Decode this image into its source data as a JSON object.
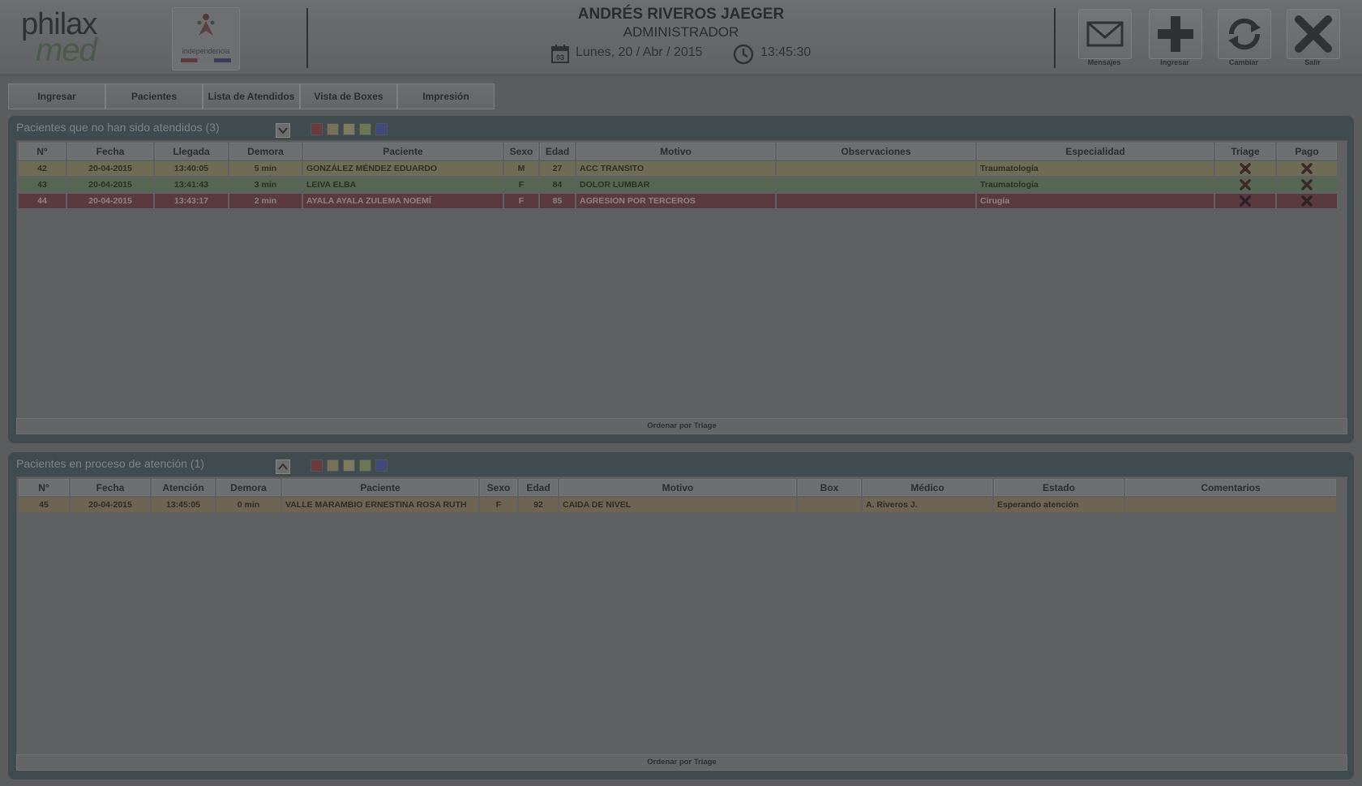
{
  "header": {
    "logo_top": "philax",
    "logo_bottom": "med",
    "municipality": "independencia",
    "user_name": "ANDRÉS RIVEROS JAEGER",
    "user_role": "ADMINISTRADOR",
    "date": "Lunes, 20 / Abr / 2015",
    "time": "13:45:30",
    "buttons": [
      {
        "label": "Mensajes",
        "icon": "envelope-icon"
      },
      {
        "label": "Ingresar",
        "icon": "plus-icon"
      },
      {
        "label": "Cambiar",
        "icon": "refresh-icon"
      },
      {
        "label": "Salir",
        "icon": "close-icon"
      }
    ]
  },
  "tabs": [
    "Ingresar",
    "Pacientes",
    "Lista de Atendidos",
    "Vista de Boxes",
    "Impresión"
  ],
  "triage_colors": [
    "#6a3a3d",
    "#76715a",
    "#7c7a5f",
    "#6a7858",
    "#3e4a78"
  ],
  "waiting": {
    "title": "Pacientes que no han sido atendidos (3)",
    "columns": [
      "N°",
      "Fecha",
      "Llegada",
      "Demora",
      "Paciente",
      "Sexo",
      "Edad",
      "Motivo",
      "Observaciones",
      "Especialidad",
      "Triage",
      "Pago"
    ],
    "rows": [
      {
        "n": "42",
        "fecha": "20-04-2015",
        "llegada": "13:40:05",
        "demora": "5 min",
        "paciente": "GONZÁLEZ MÉNDEZ EDUARDO",
        "sexo": "M",
        "edad": "27",
        "motivo": "ACC TRANSITO",
        "obs": "",
        "especialidad": "Traumatología",
        "color": "yellow"
      },
      {
        "n": "43",
        "fecha": "20-04-2015",
        "llegada": "13:41:43",
        "demora": "3 min",
        "paciente": "LEIVA ELBA",
        "sexo": "F",
        "edad": "84",
        "motivo": "DOLOR LUMBAR",
        "obs": "",
        "especialidad": "Traumatología",
        "color": "green"
      },
      {
        "n": "44",
        "fecha": "20-04-2015",
        "llegada": "13:43:17",
        "demora": "2 min",
        "paciente": "AYALA AYALA ZULEMA NOEMÍ",
        "sexo": "F",
        "edad": "85",
        "motivo": "AGRESION POR TERCEROS",
        "obs": "",
        "especialidad": "Cirugía",
        "color": "red"
      }
    ],
    "footer": "Ordenar por Triage"
  },
  "in_process": {
    "title": "Pacientes en proceso de atención (1)",
    "columns": [
      "N°",
      "Fecha",
      "Atención",
      "Demora",
      "Paciente",
      "Sexo",
      "Edad",
      "Motivo",
      "Box",
      "Médico",
      "Estado",
      "Comentarios"
    ],
    "rows": [
      {
        "n": "45",
        "fecha": "20-04-2015",
        "atencion": "13:45:05",
        "demora": "0 min",
        "paciente": "VALLE MARAMBIO ERNESTINA ROSA RUTH",
        "sexo": "F",
        "edad": "92",
        "motivo": "CAIDA DE NIVEL",
        "box": "",
        "medico": "A. Riveros J.",
        "estado": "Esperando atención",
        "comentarios": "",
        "color": "orange"
      }
    ],
    "footer": "Ordenar por Triage"
  }
}
